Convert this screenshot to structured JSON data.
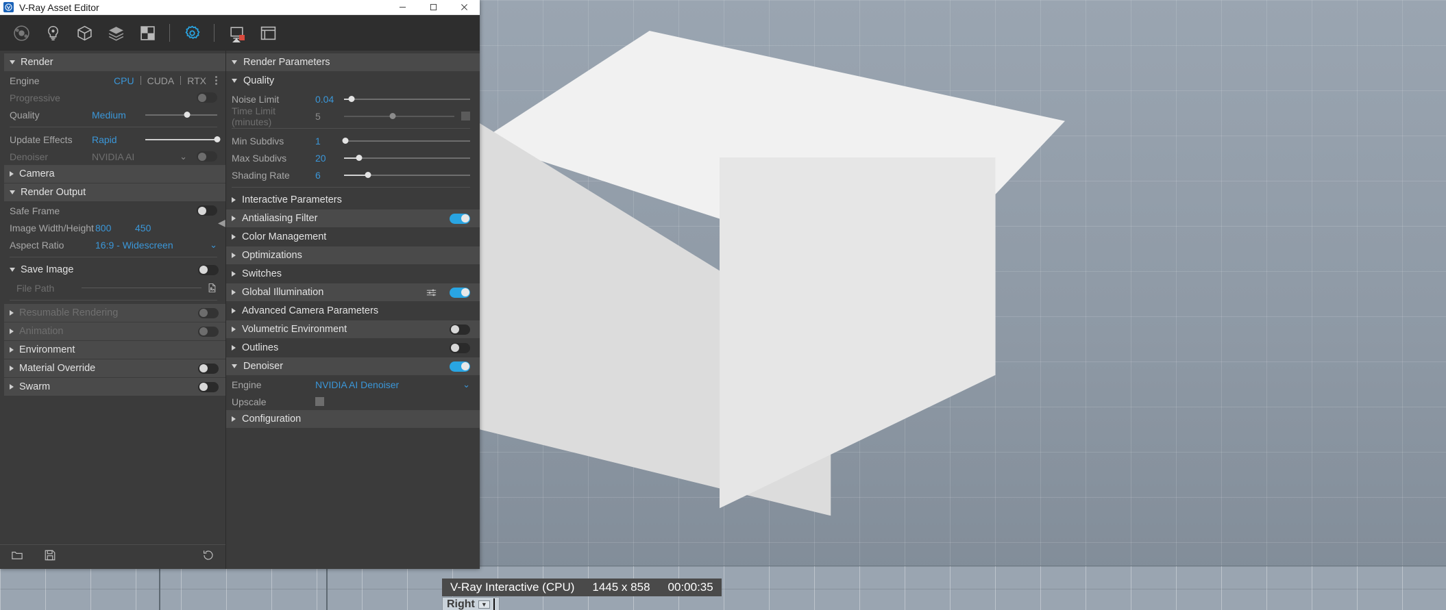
{
  "window": {
    "title": "V-Ray Asset Editor",
    "minimize_label": "Minimize",
    "maximize_label": "Maximize",
    "close_label": "Close"
  },
  "toolbar": {
    "icons": [
      {
        "name": "material-editor-icon",
        "label": "Materials"
      },
      {
        "name": "light-editor-icon",
        "label": "Lights"
      },
      {
        "name": "geometry-editor-icon",
        "label": "Geometry"
      },
      {
        "name": "texture-editor-icon",
        "label": "Textures"
      },
      {
        "name": "render-elements-icon",
        "label": "Render Elements"
      },
      {
        "name": "settings-gear-icon",
        "label": "Settings"
      },
      {
        "name": "render-icon",
        "label": "Render"
      },
      {
        "name": "vfb-icon",
        "label": "Frame Buffer"
      }
    ]
  },
  "left_panel": {
    "render_section": {
      "label": "Render",
      "engine": {
        "label": "Engine",
        "options": [
          "CPU",
          "CUDA",
          "RTX"
        ],
        "selected": "CPU"
      },
      "progressive": {
        "label": "Progressive",
        "value": "on"
      },
      "quality": {
        "label": "Quality",
        "value": "Medium",
        "slider_percent": 58
      },
      "update_effects": {
        "label": "Update Effects",
        "value": "Rapid",
        "slider_percent": 100
      },
      "denoiser": {
        "label": "Denoiser",
        "value": "NVIDIA AI",
        "toggle": "on"
      }
    },
    "camera_section": {
      "label": "Camera"
    },
    "render_output": {
      "label": "Render Output",
      "safe_frame": {
        "label": "Safe Frame",
        "value": "off"
      },
      "image_size": {
        "label": "Image Width/Height",
        "width": "800",
        "height": "450"
      },
      "aspect_ratio": {
        "label": "Aspect Ratio",
        "value": "16:9 - Widescreen"
      }
    },
    "save_image": {
      "label": "Save Image",
      "toggle": "off",
      "file_path_label": "File Path",
      "file_path_value": "",
      "browse_icon": "file-image-icon"
    },
    "collapsible_sections": [
      {
        "label": "Resumable Rendering",
        "toggle": "off",
        "dimmed": true
      },
      {
        "label": "Animation",
        "toggle": "off",
        "dimmed": true
      },
      {
        "label": "Environment",
        "toggle": null,
        "dimmed": false
      },
      {
        "label": "Material Override",
        "toggle": "off",
        "dimmed": false
      },
      {
        "label": "Swarm",
        "toggle": "off",
        "dimmed": false
      }
    ],
    "footer": {
      "open_icon": "folder-open-icon",
      "save_icon": "floppy-save-icon",
      "reset_icon": "reset-revert-icon"
    },
    "collapse_handle": "◀"
  },
  "right_panel": {
    "header": "Render Parameters",
    "quality_section": {
      "label": "Quality",
      "rows": [
        {
          "label": "Noise Limit",
          "value": "0.04",
          "slider_percent": 6,
          "disabled": false,
          "has_checkbox": false
        },
        {
          "label": "Time Limit (minutes)",
          "value": "5",
          "slider_percent": 44,
          "disabled": true,
          "has_checkbox": true
        },
        {
          "label": "Min Subdivs",
          "value": "1",
          "slider_percent": 1,
          "disabled": false,
          "has_checkbox": false
        },
        {
          "label": "Max Subdivs",
          "value": "20",
          "slider_percent": 12,
          "disabled": false,
          "has_checkbox": false
        },
        {
          "label": "Shading Rate",
          "value": "6",
          "slider_percent": 19,
          "disabled": false,
          "has_checkbox": false
        }
      ]
    },
    "sections": [
      {
        "label": "Interactive Parameters",
        "toggle": null,
        "expanded": false,
        "mixer": false
      },
      {
        "label": "Antialiasing Filter",
        "toggle": "on",
        "expanded": false,
        "mixer": false
      },
      {
        "label": "Color Management",
        "toggle": null,
        "expanded": false,
        "mixer": false
      },
      {
        "label": "Optimizations",
        "toggle": null,
        "expanded": false,
        "mixer": false
      },
      {
        "label": "Switches",
        "toggle": null,
        "expanded": false,
        "mixer": false
      },
      {
        "label": "Global Illumination",
        "toggle": "on",
        "expanded": false,
        "mixer": true
      },
      {
        "label": "Advanced Camera Parameters",
        "toggle": null,
        "expanded": false,
        "mixer": false
      },
      {
        "label": "Volumetric Environment",
        "toggle": "off",
        "expanded": false,
        "mixer": false
      },
      {
        "label": "Outlines",
        "toggle": "off",
        "expanded": false,
        "mixer": false
      }
    ],
    "denoiser_section": {
      "label": "Denoiser",
      "toggle": "on",
      "engine": {
        "label": "Engine",
        "value": "NVIDIA AI Denoiser"
      },
      "upscale": {
        "label": "Upscale",
        "checked": false
      }
    },
    "configuration_section": {
      "label": "Configuration"
    }
  },
  "status_bar": {
    "renderer": "V-Ray Interactive (CPU)",
    "resolution": "1445 x 858",
    "elapsed": "00:00:35"
  },
  "viewport": {
    "view_label": "Right",
    "view_caret": "▼"
  },
  "colors": {
    "accent_blue": "#3b97d9",
    "toggle_on": "#29a5e3",
    "panel_bg": "#3b3b3b",
    "section_bg": "#4a4a4a"
  }
}
